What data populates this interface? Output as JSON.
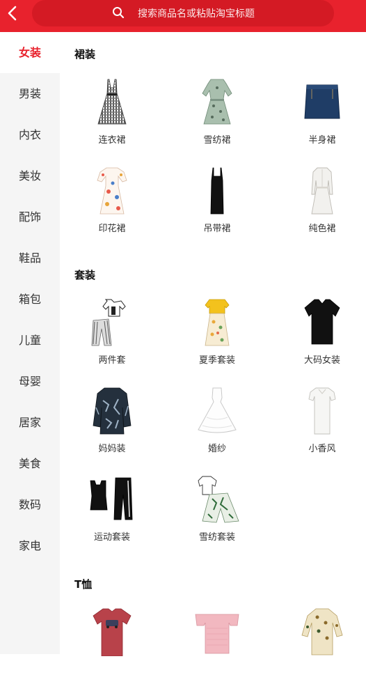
{
  "header": {
    "back_icon": "chevron-left-icon",
    "search_icon": "search-icon",
    "search_placeholder": "搜索商品名或粘贴淘宝标题",
    "background_color": "#e8222d"
  },
  "sidebar": {
    "active_color": "#e8222d",
    "items": [
      {
        "label": "女装",
        "active": true
      },
      {
        "label": "男装"
      },
      {
        "label": "内衣"
      },
      {
        "label": "美妆"
      },
      {
        "label": "配饰"
      },
      {
        "label": "鞋品"
      },
      {
        "label": "箱包"
      },
      {
        "label": "儿童"
      },
      {
        "label": "母婴"
      },
      {
        "label": "居家"
      },
      {
        "label": "美食"
      },
      {
        "label": "数码"
      },
      {
        "label": "家电"
      }
    ]
  },
  "sections": [
    {
      "title": "裙装",
      "items": [
        {
          "label": "连衣裙",
          "icon": "plaid-dress-icon"
        },
        {
          "label": "雪纺裙",
          "icon": "chiffon-dress-icon"
        },
        {
          "label": "半身裙",
          "icon": "denim-skirt-icon"
        },
        {
          "label": "印花裙",
          "icon": "print-dress-icon"
        },
        {
          "label": "吊带裙",
          "icon": "slip-dress-icon"
        },
        {
          "label": "纯色裙",
          "icon": "solid-dress-icon"
        }
      ]
    },
    {
      "title": "套装",
      "items": [
        {
          "label": "两件套",
          "icon": "two-piece-set-icon"
        },
        {
          "label": "夏季套装",
          "icon": "summer-set-icon"
        },
        {
          "label": "大码女装",
          "icon": "plus-size-top-icon"
        },
        {
          "label": "妈妈装",
          "icon": "mom-blouse-icon"
        },
        {
          "label": "婚纱",
          "icon": "wedding-dress-icon"
        },
        {
          "label": "小香风",
          "icon": "white-shirt-dress-icon"
        },
        {
          "label": "运动套装",
          "icon": "sports-set-icon"
        },
        {
          "label": "雪纺套装",
          "icon": "chiffon-set-icon"
        }
      ]
    },
    {
      "title": "T恤",
      "items": [
        {
          "label": "",
          "icon": "red-tshirt-icon"
        },
        {
          "label": "",
          "icon": "pink-offshoulder-top-icon"
        },
        {
          "label": "",
          "icon": "floral-top-icon"
        }
      ]
    }
  ]
}
